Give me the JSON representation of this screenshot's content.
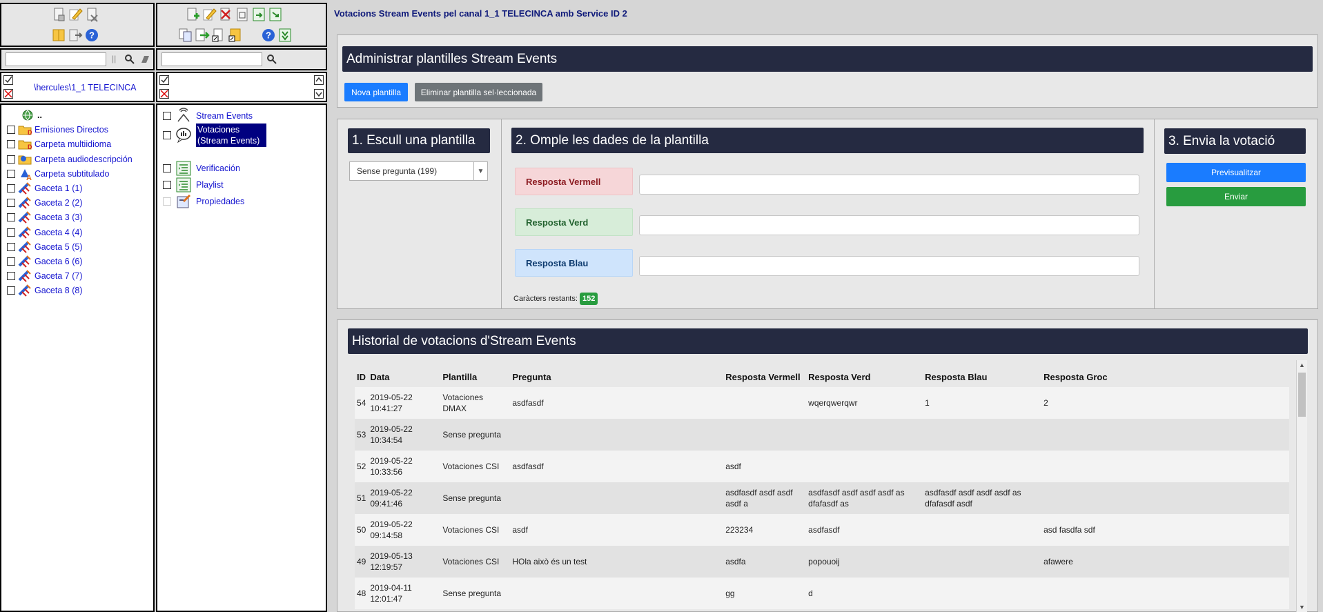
{
  "left": {
    "path": "\\hercules\\1_1 TELECINCA",
    "tree": [
      {
        "label": "..",
        "icon": "globe-icon"
      },
      {
        "label": "Emisiones Directos",
        "icon": "folder-d-icon"
      },
      {
        "label": "Carpeta multiidioma",
        "icon": "folder-d-icon"
      },
      {
        "label": "Carpeta audiodescripción",
        "icon": "folder-audio-icon"
      },
      {
        "label": "Carpeta subtitulado",
        "icon": "folder-subtitle-icon"
      },
      {
        "label": "Gaceta 1 (1)",
        "icon": "satellite-icon"
      },
      {
        "label": "Gaceta 2 (2)",
        "icon": "satellite-icon"
      },
      {
        "label": "Gaceta 3 (3)",
        "icon": "satellite-icon"
      },
      {
        "label": "Gaceta 4 (4)",
        "icon": "satellite-icon"
      },
      {
        "label": "Gaceta 5 (5)",
        "icon": "satellite-icon"
      },
      {
        "label": "Gaceta 6 (6)",
        "icon": "satellite-icon"
      },
      {
        "label": "Gaceta 7 (7)",
        "icon": "satellite-icon"
      },
      {
        "label": "Gaceta 8 (8)",
        "icon": "satellite-icon"
      }
    ]
  },
  "middle": {
    "items": [
      {
        "label": "Stream Events",
        "icon": "antenna-icon"
      },
      {
        "label": "Votaciones (Stream Events)",
        "icon": "chat-chart-icon",
        "selected": true
      },
      {
        "label": "Verificación",
        "icon": "list-icon"
      },
      {
        "label": "Playlist",
        "icon": "list-icon"
      },
      {
        "label": "Propiedades",
        "icon": "properties-icon"
      }
    ]
  },
  "main": {
    "title": "Votacions Stream Events pel canal 1_1 TELECINCA amb Service ID 2",
    "admin": {
      "header": "Administrar plantilles Stream Events",
      "new_label": "Nova plantilla",
      "delete_label": "Eliminar plantilla sel·leccionada"
    },
    "step1": {
      "header": "1. Escull una plantilla",
      "selected": "Sense pregunta (199)"
    },
    "step2": {
      "header": "2. Omple les dades de la plantilla",
      "red_label": "Resposta Vermell",
      "green_label": "Resposta Verd",
      "blue_label": "Resposta Blau",
      "remaining_label": "Caràcters restants:",
      "remaining_count": "152"
    },
    "step3": {
      "header": "3. Envia la votació",
      "preview_label": "Previsualitzar",
      "send_label": "Enviar"
    },
    "history": {
      "header": "Historial de votacions d'Stream Events",
      "columns": [
        "ID",
        "Data",
        "Plantilla",
        "Pregunta",
        "Resposta Vermell",
        "Resposta Verd",
        "Resposta Blau",
        "Resposta Groc"
      ],
      "rows": [
        [
          "54",
          "2019-05-22 10:41:27",
          "Votaciones DMAX",
          "asdfasdf",
          "",
          "wqerqwerqwr",
          "1",
          "2"
        ],
        [
          "53",
          "2019-05-22 10:34:54",
          "Sense pregunta",
          "",
          "",
          "",
          "",
          ""
        ],
        [
          "52",
          "2019-05-22 10:33:56",
          "Votaciones CSI",
          "asdfasdf",
          "asdf",
          "",
          "",
          ""
        ],
        [
          "51",
          "2019-05-22 09:41:46",
          "Sense pregunta",
          "",
          "asdfasdf asdf asdf asdf a",
          "asdfasdf asdf asdf asdf as dfafasdf as",
          "asdfasdf asdf asdf asdf as dfafasdf asdf",
          ""
        ],
        [
          "50",
          "2019-05-22 09:14:58",
          "Votaciones CSI",
          "asdf",
          "223234",
          "asdfasdf",
          "",
          "asd fasdfa sdf"
        ],
        [
          "49",
          "2019-05-13 12:19:57",
          "Votaciones CSI",
          "HOla això és un test",
          "asdfa",
          "popouoij",
          "",
          "afawere"
        ],
        [
          "48",
          "2019-04-11 12:01:47",
          "Sense pregunta",
          "",
          "gg",
          "d",
          "",
          ""
        ]
      ]
    }
  }
}
